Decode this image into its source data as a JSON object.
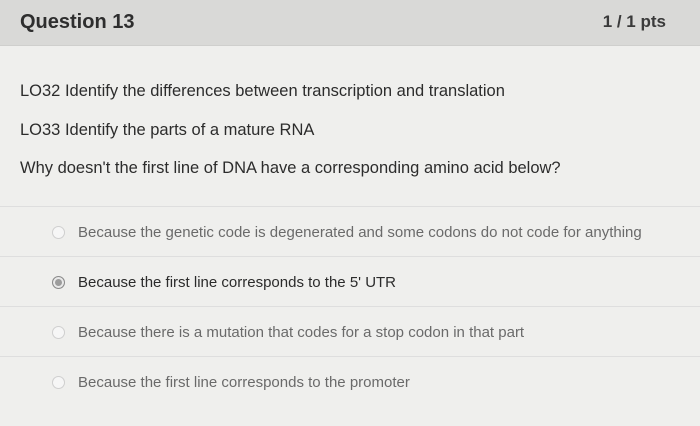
{
  "question": {
    "title": "Question 13",
    "points": "1 / 1 pts",
    "lines": [
      "LO32 Identify the differences between transcription and translation",
      "LO33 Identify the parts of a mature RNA",
      "Why doesn't the first line of DNA have a corresponding amino acid below?"
    ]
  },
  "answers": [
    {
      "text": "Because the genetic code is degenerated and some codons do not code for anything",
      "selected": false
    },
    {
      "text": "Because the first line corresponds to the 5' UTR",
      "selected": true
    },
    {
      "text": "Because there is a mutation that codes for a stop codon in that part",
      "selected": false
    },
    {
      "text": "Because the first line corresponds to the promoter",
      "selected": false
    }
  ],
  "colors": {
    "background": "#efefed",
    "header": "#d9d9d7",
    "selected_radio": "#9c9c9c"
  }
}
